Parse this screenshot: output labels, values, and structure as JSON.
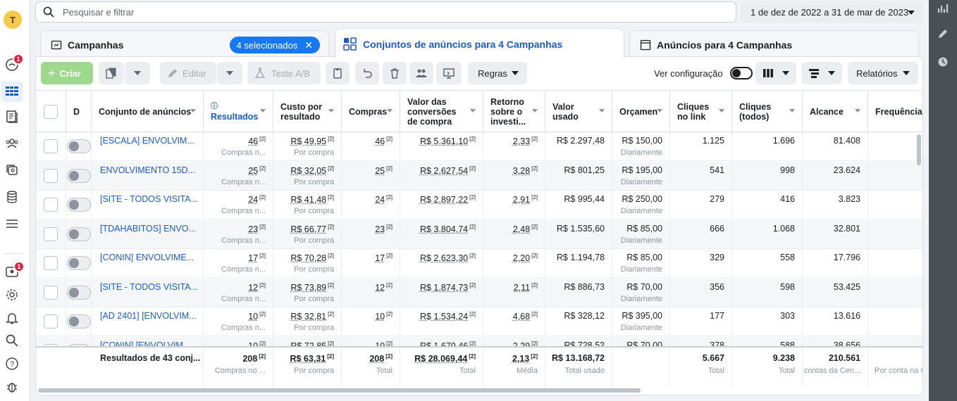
{
  "search": {
    "placeholder": "Pesquisar e filtrar"
  },
  "date_range": "1 de dez de 2022 a 31 de mar de 2023",
  "avatar_letter": "T",
  "badges": {
    "notifications": "1",
    "account": "1"
  },
  "tabs": {
    "campaigns": "Campanhas",
    "selected_pill": "4 selecionados",
    "adsets": "Conjuntos de anúncios para 4 Campanhas",
    "ads": "Anúncios para 4 Campanhas"
  },
  "toolbar": {
    "create": "Criar",
    "edit": "Editar",
    "ab_test": "Teste A/B",
    "rules": "Regras",
    "view_config": "Ver configuração",
    "reports": "Relatórios"
  },
  "columns": {
    "delivery": "D",
    "name": "Conjunto de anúncios",
    "results": "Resultados",
    "cost_per_result": "Custo por resultado",
    "purchases": "Compras",
    "conv_value": "Valor das conversões de compra",
    "roas": "Retorno sobre o investi...",
    "spent": "Valor usado",
    "budget": "Orçamen",
    "link_clicks": "Cliques no link",
    "all_clicks": "Cliques (todos)",
    "reach": "Alcance",
    "frequency": "Frequência"
  },
  "rows": [
    {
      "name": "[ESCALA] ENVOLVIM...",
      "results": "46",
      "results_sub": "Compras n...",
      "cpr": "R$ 49,95",
      "cpr_sub": "Por compra",
      "purchases": "46",
      "conv_value": "R$ 5.361,10",
      "roas": "2,33",
      "spent": "R$ 2.297,48",
      "budget": "R$ 150,00",
      "budget_sub": "Diariamente",
      "link_clicks": "1.125",
      "all_clicks": "1.696",
      "reach": "81.408"
    },
    {
      "name": "ENVOLVIMENTO 15D...",
      "results": "25",
      "results_sub": "Compras n...",
      "cpr": "R$ 32,05",
      "cpr_sub": "Por compra",
      "purchases": "25",
      "conv_value": "R$ 2.627,54",
      "roas": "3,28",
      "spent": "R$ 801,25",
      "budget": "R$ 195,00",
      "budget_sub": "Diariamente",
      "link_clicks": "541",
      "all_clicks": "998",
      "reach": "23.624"
    },
    {
      "name": "[SITE - TODOS VISITA...",
      "results": "24",
      "results_sub": "Compras n...",
      "cpr": "R$ 41,48",
      "cpr_sub": "Por compra",
      "purchases": "24",
      "conv_value": "R$ 2.897,22",
      "roas": "2,91",
      "spent": "R$ 995,44",
      "budget": "R$ 250,00",
      "budget_sub": "Diariamente",
      "link_clicks": "279",
      "all_clicks": "416",
      "reach": "3.823"
    },
    {
      "name": "[TDAHABITOS] ENVO...",
      "results": "23",
      "results_sub": "Compras n...",
      "cpr": "R$ 66,77",
      "cpr_sub": "Por compra",
      "purchases": "23",
      "conv_value": "R$ 3.804,74",
      "roas": "2,48",
      "spent": "R$ 1.535,60",
      "budget": "R$ 85,00",
      "budget_sub": "Diariamente",
      "link_clicks": "666",
      "all_clicks": "1.068",
      "reach": "32.801"
    },
    {
      "name": "[CONIN] ENVOLVIME...",
      "results": "17",
      "results_sub": "Compras n...",
      "cpr": "R$ 70,28",
      "cpr_sub": "Por compra",
      "purchases": "17",
      "conv_value": "R$ 2.623,30",
      "roas": "2,20",
      "spent": "R$ 1.194,78",
      "budget": "R$ 85,00",
      "budget_sub": "Diariamente",
      "link_clicks": "329",
      "all_clicks": "558",
      "reach": "17.796"
    },
    {
      "name": "[SITE - TODOS VISITA...",
      "results": "12",
      "results_sub": "Compras n...",
      "cpr": "R$ 73,89",
      "cpr_sub": "Por compra",
      "purchases": "12",
      "conv_value": "R$ 1.874,73",
      "roas": "2,11",
      "spent": "R$ 886,73",
      "budget": "R$ 70,00",
      "budget_sub": "Diariamente",
      "link_clicks": "356",
      "all_clicks": "598",
      "reach": "53.425"
    },
    {
      "name": "[AD 2401] [ENVOLVIM...",
      "results": "10",
      "results_sub": "Compras n...",
      "cpr": "R$ 32,81",
      "cpr_sub": "Por compra",
      "purchases": "10",
      "conv_value": "R$ 1.534,24",
      "roas": "4,68",
      "spent": "R$ 328,12",
      "budget": "R$ 395,00",
      "budget_sub": "Diariamente",
      "link_clicks": "177",
      "all_clicks": "303",
      "reach": "13.616"
    },
    {
      "name": "[CONIN] [ENVOLVIM...",
      "results": "10",
      "results_sub": "",
      "cpr": "R$ 72,85",
      "cpr_sub": "",
      "purchases": "10",
      "conv_value": "R$ 1.670,46",
      "roas": "2,29",
      "spent": "R$ 728,52",
      "budget": "R$ 70,00",
      "budget_sub": "",
      "link_clicks": "378",
      "all_clicks": "588",
      "reach": "38.656"
    }
  ],
  "totals": {
    "label": "Resultados de 43 conj...",
    "results": "208",
    "results_sub": "Compras no ...",
    "cpr": "R$ 63,31",
    "cpr_sub": "Por compra",
    "purchases": "208",
    "purchases_sub": "Total",
    "conv_value": "R$ 28.069,44",
    "conv_value_sub": "Total",
    "roas": "2,13",
    "roas_sub": "Média",
    "spent": "R$ 13.168,72",
    "spent_sub": "Total usado",
    "link_clicks": "5.667",
    "link_clicks_sub": "Total",
    "all_clicks": "9.238",
    "all_clicks_sub": "Total",
    "reach": "210.561",
    "reach_sub": "contas da Cen...",
    "frequency_sub": "Por conta na C"
  },
  "footnote_mark": "[2]",
  "colors": {
    "accent": "#1877f2",
    "link": "#1a5bcc",
    "create": "#9fd98f"
  }
}
